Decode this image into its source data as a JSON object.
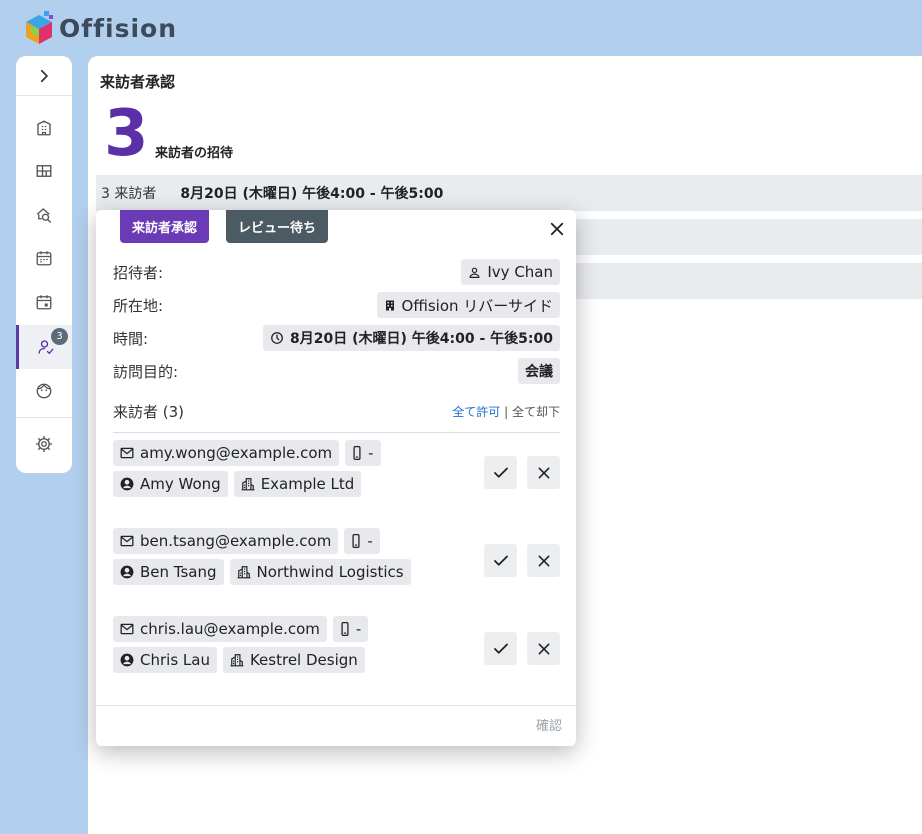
{
  "app": {
    "name": "Offision"
  },
  "sidebar": {
    "expand_icon": "chevron-right-icon",
    "items": [
      {
        "name": "office-building",
        "icon": "building-icon"
      },
      {
        "name": "floor-map",
        "icon": "map-icon"
      },
      {
        "name": "search-space",
        "icon": "search-space-icon"
      },
      {
        "name": "calendar",
        "icon": "calendar-icon"
      },
      {
        "name": "calendar-event",
        "icon": "calendar-event-icon"
      },
      {
        "name": "visitor-approval",
        "icon": "user-check-icon",
        "badge": "3",
        "active": true
      },
      {
        "name": "face-recognition",
        "icon": "face-icon"
      },
      {
        "name": "settings",
        "icon": "gear-icon"
      }
    ]
  },
  "main": {
    "title": "来訪者承認",
    "count": "3",
    "count_label": "来訪者の招待",
    "first_row": {
      "count": "3 来訪者",
      "when": "8月20日 (木曜日) 午後4:00 - 午後5:00"
    }
  },
  "popover": {
    "approve_button": "来訪者承認",
    "review_button": "レビュー待ち",
    "fields": {
      "host_label": "招待者:",
      "host_value": "Ivy Chan",
      "location_label": "所在地:",
      "location_value": "Offision リバーサイド",
      "time_label": "時間:",
      "time_value": "8月20日 (木曜日) 午後4:00 - 午後5:00",
      "purpose_label": "訪問目的:",
      "purpose_value": "会議"
    },
    "visitors_title": "来訪者 (3)",
    "allow_all": "全て許可",
    "separator": "|",
    "reject_all": "全て却下",
    "visitors": [
      {
        "email": "amy.wong@example.com",
        "phone": "-",
        "name": "Amy Wong",
        "company": "Example Ltd"
      },
      {
        "email": "ben.tsang@example.com",
        "phone": "-",
        "name": "Ben Tsang",
        "company": "Northwind Logistics"
      },
      {
        "email": "chris.lau@example.com",
        "phone": "-",
        "name": "Chris Lau",
        "company": "Kestrel Design"
      }
    ],
    "confirm": "確認"
  },
  "colors": {
    "accent": "#5b2fa6",
    "approve": "#6a3bb5",
    "review": "#4c5a63",
    "link": "#1f6fd1",
    "background": "#b3cfee"
  }
}
